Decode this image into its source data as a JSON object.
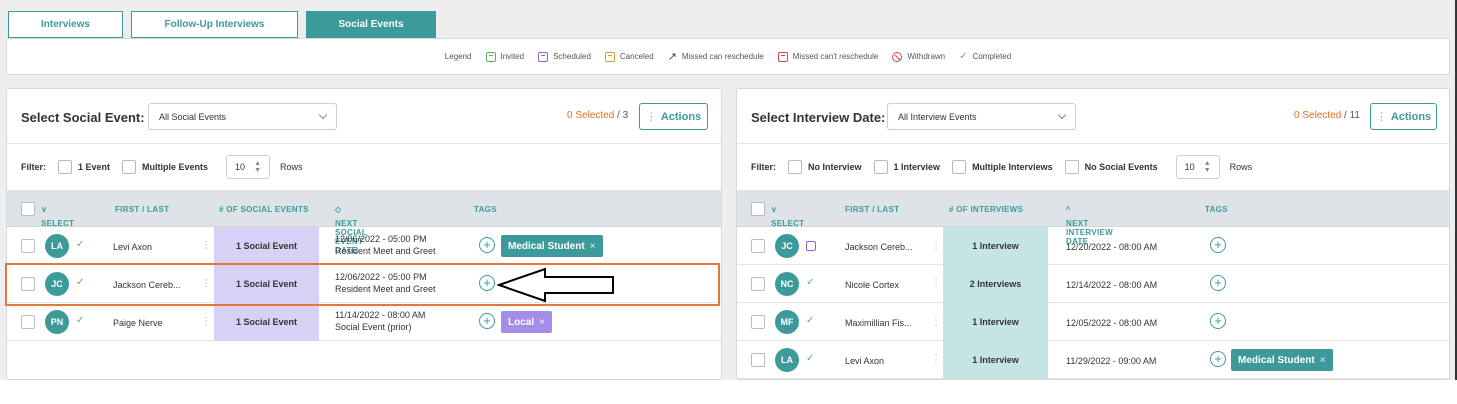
{
  "tabs": [
    {
      "label": "Interviews",
      "active": false
    },
    {
      "label": "Follow-Up Interviews",
      "active": false
    },
    {
      "label": "Social Events",
      "active": true
    }
  ],
  "legend": {
    "title": "Legend",
    "items": [
      {
        "label": "Invited",
        "icon": "invited-icon"
      },
      {
        "label": "Scheduled",
        "icon": "scheduled-icon"
      },
      {
        "label": "Canceled",
        "icon": "canceled-icon"
      },
      {
        "label": "Missed can reschedule",
        "icon": "missed-reschedule-icon"
      },
      {
        "label": "Missed can't reschedule",
        "icon": "missed-no-reschedule-icon"
      },
      {
        "label": "Withdrawn",
        "icon": "withdrawn-icon"
      },
      {
        "label": "Completed",
        "icon": "completed-icon"
      }
    ]
  },
  "left_panel": {
    "title": "Select Social Event:",
    "select_value": "All Social Events",
    "selected_count": "0 Selected",
    "total": "/ 3",
    "actions_label": "Actions",
    "filter_label": "Filter:",
    "filters": [
      "1 Event",
      "Multiple Events"
    ],
    "rows_value": "10",
    "rows_label": "Rows",
    "columns": [
      "SELECT",
      "FIRST / LAST",
      "# OF SOCIAL EVENTS",
      "NEXT SOCIAL EVENT DATE",
      "TAGS"
    ],
    "rows": [
      {
        "initials": "LA",
        "name": "Levi Axon",
        "count": "1 Social Event",
        "date": "12/06/2022 - 05:00 PM",
        "event": "Resident Meet and Greet",
        "tag": "Medical Student",
        "tag_color": "#3d9a9a"
      },
      {
        "initials": "JC",
        "name": "Jackson Cereb...",
        "count": "1 Social Event",
        "date": "12/06/2022 - 05:00 PM",
        "event": "Resident Meet and Greet",
        "tag": "",
        "tag_color": ""
      },
      {
        "initials": "PN",
        "name": "Paige Nerve",
        "count": "1 Social Event",
        "date": "11/14/2022 - 08:00 AM",
        "event": "Social Event (prior)",
        "tag": "Local",
        "tag_color": "#a48de8"
      }
    ]
  },
  "right_panel": {
    "title": "Select Interview Date:",
    "select_value": "All Interview Events",
    "selected_count": "0 Selected",
    "total": "/ 11",
    "actions_label": "Actions",
    "filter_label": "Filter:",
    "filters": [
      "No Interview",
      "1 Interview",
      "Multiple Interviews",
      "No Social Events"
    ],
    "rows_value": "10",
    "rows_label": "Rows",
    "columns": [
      "SELECT",
      "FIRST / LAST",
      "# OF INTERVIEWS",
      "NEXT INTERVIEW DATE",
      "TAGS"
    ],
    "rows": [
      {
        "initials": "JC",
        "name": "Jackson Cereb...",
        "count": "1 Interview",
        "date": "12/20/2022 - 08:00 AM",
        "tag": ""
      },
      {
        "initials": "NC",
        "name": "Nicole Cortex",
        "count": "2 Interviews",
        "date": "12/14/2022 - 08:00 AM",
        "tag": ""
      },
      {
        "initials": "MF",
        "name": "Maximillian Fis...",
        "count": "1 Interview",
        "date": "12/05/2022 - 08:00 AM",
        "tag": ""
      },
      {
        "initials": "LA",
        "name": "Levi Axon",
        "count": "1 Interview",
        "date": "11/29/2022 - 09:00 AM",
        "tag": "Medical Student"
      }
    ]
  },
  "colors": {
    "accent": "#3d9a9a",
    "highlight": "#e07a3a",
    "selected_count": "#e07020"
  }
}
